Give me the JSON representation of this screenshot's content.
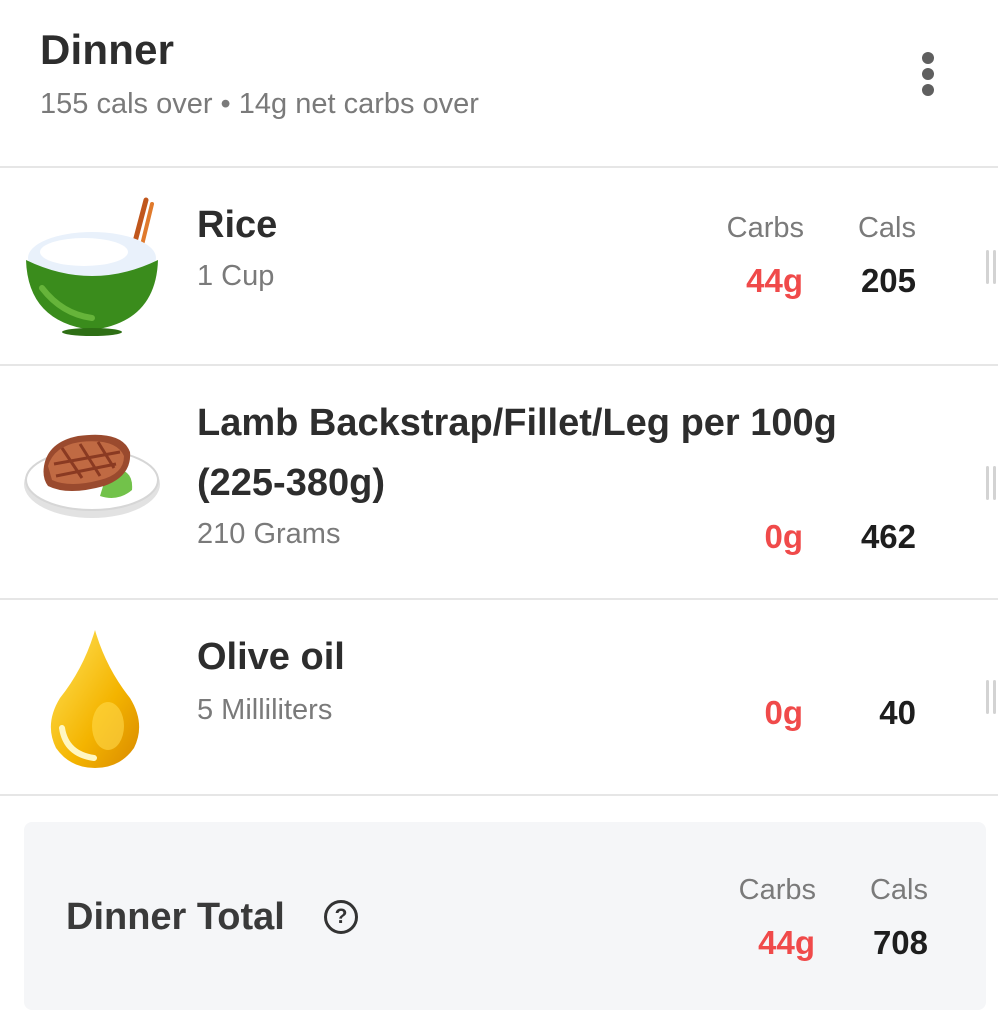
{
  "meal": {
    "title": "Dinner",
    "summary": "155 cals over • 14g net carbs over",
    "menu_icon": "more-vertical-icon"
  },
  "columns": {
    "carbs": "Carbs",
    "cals": "Cals"
  },
  "foods": [
    {
      "name": "Rice",
      "portion": "1 Cup",
      "carbs": "44g",
      "cals": "205",
      "icon": "rice-bowl-icon"
    },
    {
      "name_line1": "Lamb Backstrap/Fillet/Leg per 100g",
      "name_line2": "(225-380g)",
      "portion": "210 Grams",
      "carbs": "0g",
      "cals": "462",
      "icon": "steak-plate-icon"
    },
    {
      "name": "Olive oil",
      "portion": "5 Milliliters",
      "carbs": "0g",
      "cals": "40",
      "icon": "oil-drop-icon"
    }
  ],
  "total": {
    "label": "Dinner Total",
    "carbs": "44g",
    "cals": "708",
    "help_icon": "help-circle-icon"
  },
  "colors": {
    "carbs": "#f04a4a",
    "rice_bowl": "#3a8c1c",
    "oil": "#f4b400",
    "total_bg": "#f5f6f8"
  }
}
